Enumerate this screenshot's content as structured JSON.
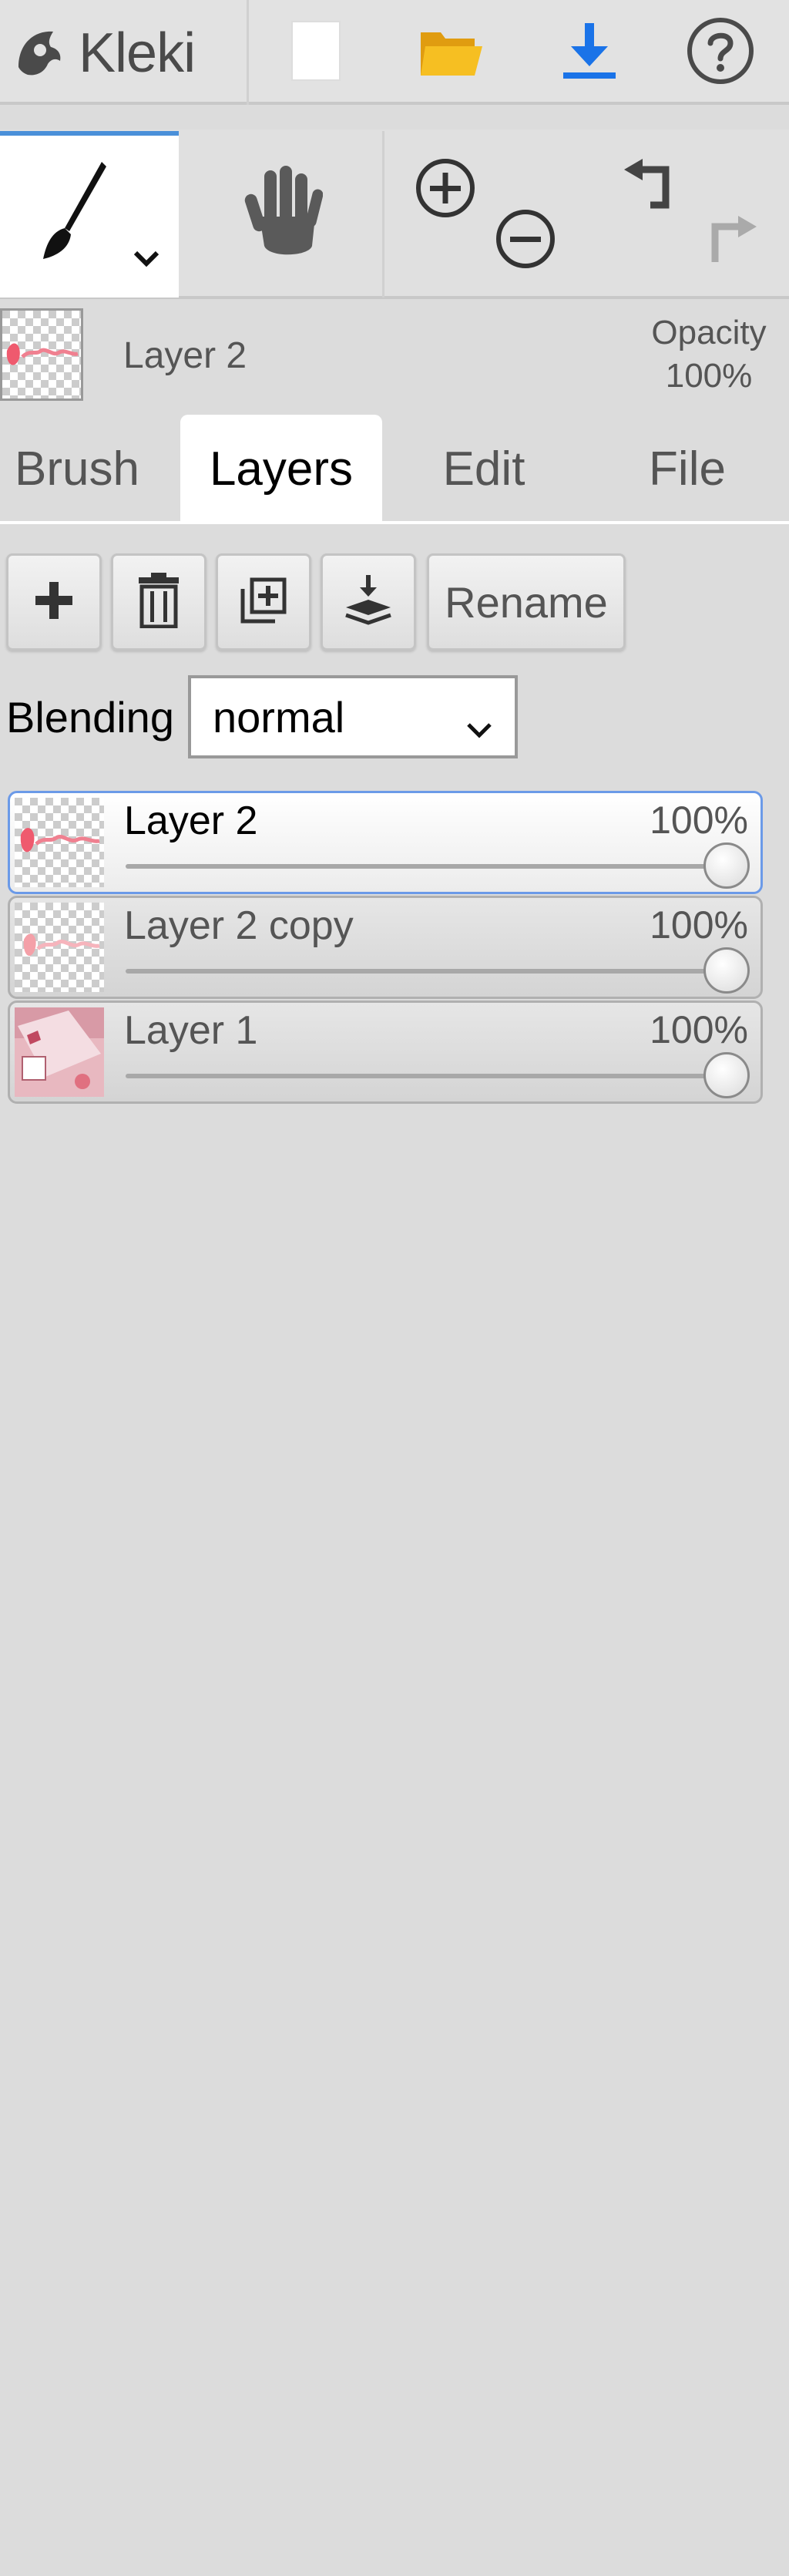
{
  "app": {
    "name": "Kleki"
  },
  "active_layer": {
    "name": "Layer 2",
    "opacity_label": "Opacity",
    "opacity_value": "100%"
  },
  "tabs": [
    {
      "label": "Brush"
    },
    {
      "label": "Layers"
    },
    {
      "label": "Edit"
    },
    {
      "label": "File"
    }
  ],
  "layer_buttons": {
    "rename_label": "Rename"
  },
  "blending": {
    "label": "Blending",
    "value": "normal"
  },
  "layers": [
    {
      "name": "Layer 2",
      "opacity_text": "100%",
      "opacity": 1.0,
      "selected": true
    },
    {
      "name": "Layer 2 copy",
      "opacity_text": "100%",
      "opacity": 1.0,
      "selected": false
    },
    {
      "name": "Layer 1",
      "opacity_text": "100%",
      "opacity": 1.0,
      "selected": false
    }
  ],
  "colors": {
    "accent": "#4a90d9",
    "download": "#1a73e8",
    "folder": "#f3b71a",
    "selection_border": "#6b9ae8"
  },
  "icons": [
    "kleki-logo-icon",
    "new-file-icon",
    "open-folder-icon",
    "download-icon",
    "help-icon",
    "brush-icon",
    "chevron-down-icon",
    "hand-icon",
    "zoom-in-icon",
    "zoom-out-icon",
    "undo-icon",
    "redo-icon",
    "add-layer-icon",
    "delete-layer-icon",
    "duplicate-layer-icon",
    "merge-down-icon"
  ]
}
